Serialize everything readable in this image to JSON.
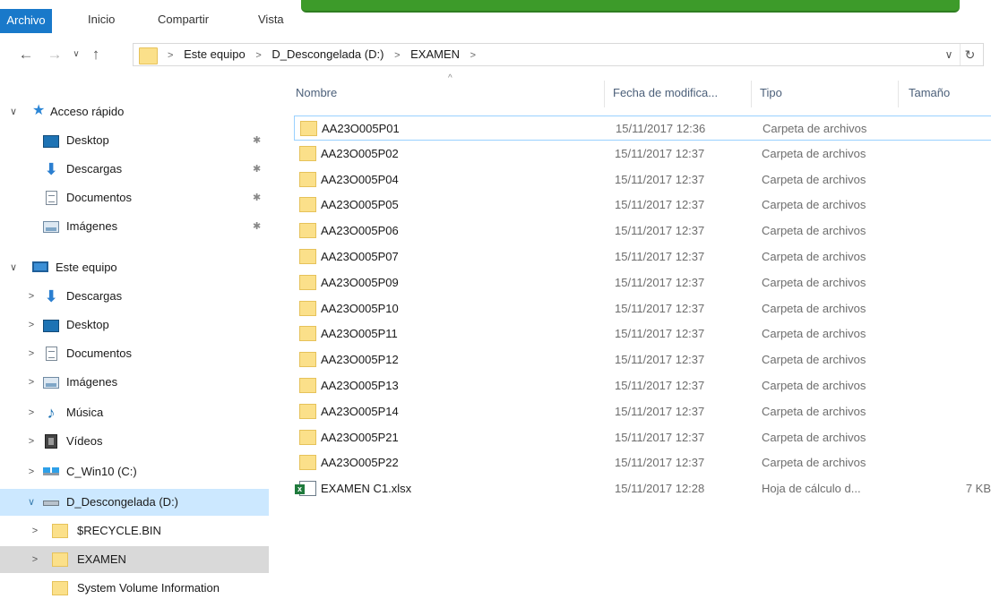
{
  "ribbon": {
    "tabs": [
      "Archivo",
      "Inicio",
      "Compartir",
      "Vista"
    ]
  },
  "address": {
    "crumbs": [
      "Este equipo",
      "D_Descongelada (D:)",
      "EXAMEN"
    ]
  },
  "nav": {
    "quick_access": "Acceso rápido",
    "quick_items": [
      "Desktop",
      "Descargas",
      "Documentos",
      "Imágenes"
    ],
    "this_pc": "Este equipo",
    "pc_items": [
      "Descargas",
      "Desktop",
      "Documentos",
      "Imágenes",
      "Música",
      "Vídeos",
      "C_Win10 (C:)",
      "D_Descongelada (D:)"
    ],
    "d_children": [
      "$RECYCLE.BIN",
      "EXAMEN",
      "System Volume Information"
    ]
  },
  "columns": {
    "name": "Nombre",
    "date": "Fecha de modifica...",
    "type": "Tipo",
    "size": "Tamaño"
  },
  "files": [
    {
      "name": "AA23O005P01",
      "date": "15/11/2017 12:36",
      "type": "Carpeta de archivos",
      "size": ""
    },
    {
      "name": "AA23O005P02",
      "date": "15/11/2017 12:37",
      "type": "Carpeta de archivos",
      "size": ""
    },
    {
      "name": "AA23O005P04",
      "date": "15/11/2017 12:37",
      "type": "Carpeta de archivos",
      "size": ""
    },
    {
      "name": "AA23O005P05",
      "date": "15/11/2017 12:37",
      "type": "Carpeta de archivos",
      "size": ""
    },
    {
      "name": "AA23O005P06",
      "date": "15/11/2017 12:37",
      "type": "Carpeta de archivos",
      "size": ""
    },
    {
      "name": "AA23O005P07",
      "date": "15/11/2017 12:37",
      "type": "Carpeta de archivos",
      "size": ""
    },
    {
      "name": "AA23O005P09",
      "date": "15/11/2017 12:37",
      "type": "Carpeta de archivos",
      "size": ""
    },
    {
      "name": "AA23O005P10",
      "date": "15/11/2017 12:37",
      "type": "Carpeta de archivos",
      "size": ""
    },
    {
      "name": "AA23O005P11",
      "date": "15/11/2017 12:37",
      "type": "Carpeta de archivos",
      "size": ""
    },
    {
      "name": "AA23O005P12",
      "date": "15/11/2017 12:37",
      "type": "Carpeta de archivos",
      "size": ""
    },
    {
      "name": "AA23O005P13",
      "date": "15/11/2017 12:37",
      "type": "Carpeta de archivos",
      "size": ""
    },
    {
      "name": "AA23O005P14",
      "date": "15/11/2017 12:37",
      "type": "Carpeta de archivos",
      "size": ""
    },
    {
      "name": "AA23O005P21",
      "date": "15/11/2017 12:37",
      "type": "Carpeta de archivos",
      "size": ""
    },
    {
      "name": "AA23O005P22",
      "date": "15/11/2017 12:37",
      "type": "Carpeta de archivos",
      "size": ""
    },
    {
      "name": "EXAMEN C1.xlsx",
      "date": "15/11/2017 12:28",
      "type": "Hoja de cálculo d...",
      "size": "7 KB"
    }
  ]
}
